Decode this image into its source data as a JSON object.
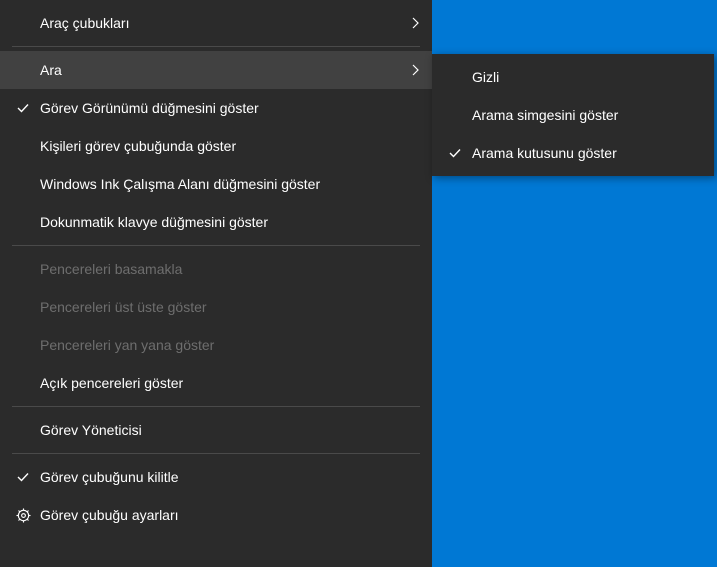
{
  "mainMenu": {
    "items": [
      {
        "label": "Araç çubukları",
        "hasSubmenu": true
      },
      {
        "label": "Ara",
        "hasSubmenu": true,
        "highlighted": true
      },
      {
        "label": "Görev Görünümü düğmesini göster",
        "checked": true
      },
      {
        "label": "Kişileri görev çubuğunda göster"
      },
      {
        "label": "Windows Ink Çalışma Alanı düğmesini göster"
      },
      {
        "label": "Dokunmatik klavye düğmesini göster"
      },
      {
        "label": "Pencereleri basamakla",
        "disabled": true
      },
      {
        "label": "Pencereleri üst üste göster",
        "disabled": true
      },
      {
        "label": "Pencereleri yan yana göster",
        "disabled": true
      },
      {
        "label": "Açık pencereleri göster"
      },
      {
        "label": "Görev Yöneticisi"
      },
      {
        "label": "Görev çubuğunu kilitle",
        "checked": true
      },
      {
        "label": "Görev çubuğu ayarları",
        "icon": "gear"
      }
    ]
  },
  "submenu": {
    "items": [
      {
        "label": "Gizli"
      },
      {
        "label": "Arama simgesini göster"
      },
      {
        "label": "Arama kutusunu göster",
        "checked": true
      }
    ]
  }
}
